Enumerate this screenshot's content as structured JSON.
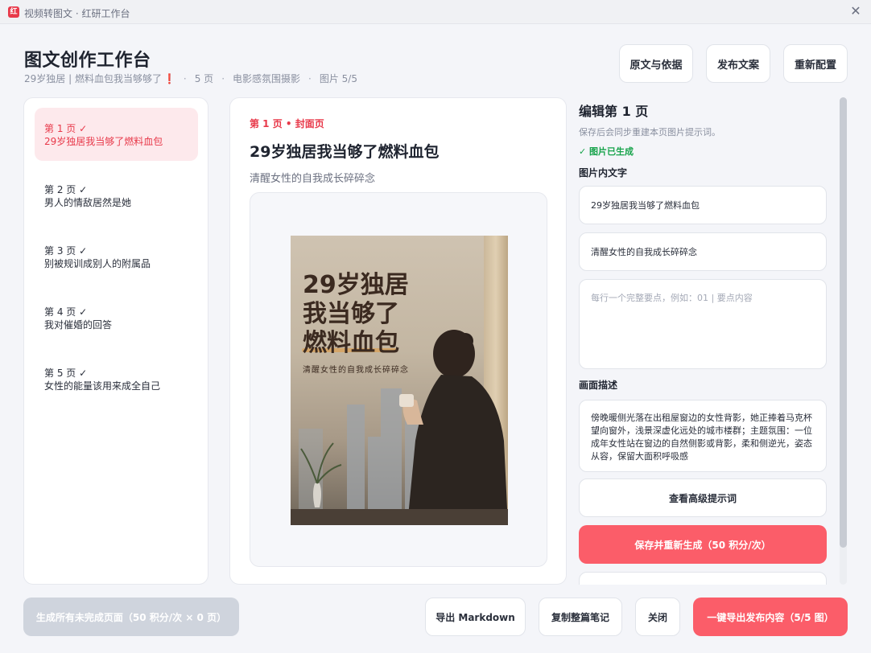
{
  "window": {
    "title": "视频转图文 · 红研工作台",
    "icon_label": "红"
  },
  "header": {
    "title": "图文创作工作台",
    "meta": {
      "topic": "29岁独居 | 燃料血包我当够够了",
      "topic_mark": "❗",
      "pages": "5 页",
      "style": "电影感氛围摄影",
      "images": "图片 5/5",
      "separator": "·"
    },
    "buttons": {
      "source": "原文与依据",
      "publish": "发布文案",
      "reconfig": "重新配置"
    }
  },
  "sidebar": {
    "items": [
      {
        "num": "第 1 页 ✓",
        "title": "29岁独居我当够了燃料血包"
      },
      {
        "num": "第 2 页 ✓",
        "title": "男人的情敌居然是她"
      },
      {
        "num": "第 3 页 ✓",
        "title": "别被规训成别人的附属品"
      },
      {
        "num": "第 4 页 ✓",
        "title": "我对催婚的回答"
      },
      {
        "num": "第 5 页 ✓",
        "title": "女性的能量该用来成全自己"
      }
    ]
  },
  "preview": {
    "label": "第 1 页 • 封面页",
    "title": "29岁独居我当够了燃料血包",
    "subtitle": "清醒女性的自我成长碎碎念",
    "cover": {
      "line1": "29岁独居",
      "line2": "我当够了",
      "line3": "燃料血包",
      "sub": "清醒女性的自我成长碎碎念"
    }
  },
  "editor": {
    "title": "编辑第 1 页",
    "hint": "保存后会同步重建本页图片提示词。",
    "status": "✓ 图片已生成",
    "text_label": "图片内文字",
    "text_line1": "29岁独居我当够了燃料血包",
    "text_line2": "清醒女性的自我成长碎碎念",
    "points_placeholder": "每行一个完整要点，例如：01 | 要点内容",
    "desc_label": "画面描述",
    "desc": "傍晚暖侧光落在出租屋窗边的女性背影，她正捧着马克杯望向窗外，浅景深虚化远处的城市楼群；主题氛围：一位成年女性站在窗边的自然侧影或背影，柔和侧逆光，姿态从容，保留大面积呼吸感",
    "advanced_btn": "查看高级提示词",
    "save_btn": "保存并重新生成（50 积分/次）"
  },
  "footer": {
    "generate_all": "生成所有未完成页面（50 积分/次 × 0 页）",
    "export_md": "导出 Markdown",
    "copy_note": "复制整篇笔记",
    "close": "关闭",
    "export_all": "一键导出发布内容（5/5 图）"
  },
  "colors": {
    "accent": "#e8394a",
    "primary_button": "#fb5d69",
    "success": "#16a34a",
    "disabled": "#cfd4dd"
  }
}
